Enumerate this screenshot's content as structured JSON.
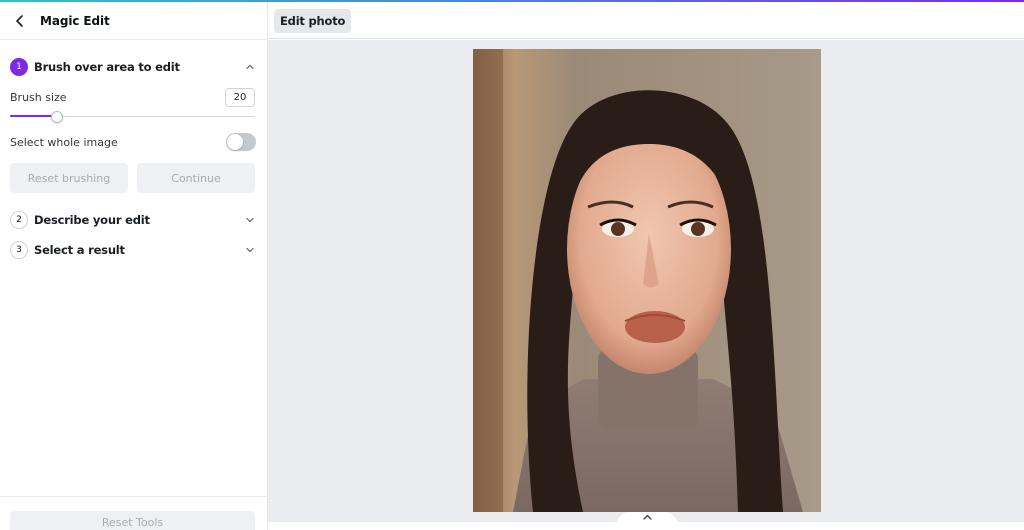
{
  "panel": {
    "title": "Magic Edit",
    "back_icon": "chevron-left-icon",
    "steps": [
      {
        "number": "1",
        "label": "Brush over area to edit",
        "expanded": true
      },
      {
        "number": "2",
        "label": "Describe your edit",
        "expanded": false
      },
      {
        "number": "3",
        "label": "Select a result",
        "expanded": false
      }
    ],
    "brush_size_label": "Brush size",
    "brush_size_value": "20",
    "brush_size_fraction": 0.19,
    "select_whole_label": "Select whole image",
    "select_whole_on": false,
    "reset_brushing_label": "Reset brushing",
    "continue_label": "Continue",
    "reset_tools_label": "Reset Tools"
  },
  "toolbar": {
    "edit_photo_label": "Edit photo"
  },
  "canvas": {
    "image_alt": "Portrait photo of a woman with long dark hair wearing a grey turtleneck",
    "collapse_icon": "chevron-up-icon"
  },
  "colors": {
    "accent": "#7d2ae8",
    "stripe_start": "#2fc1c8",
    "stripe_end": "#7d2ae8",
    "canvas_bg": "#ebecf0"
  }
}
